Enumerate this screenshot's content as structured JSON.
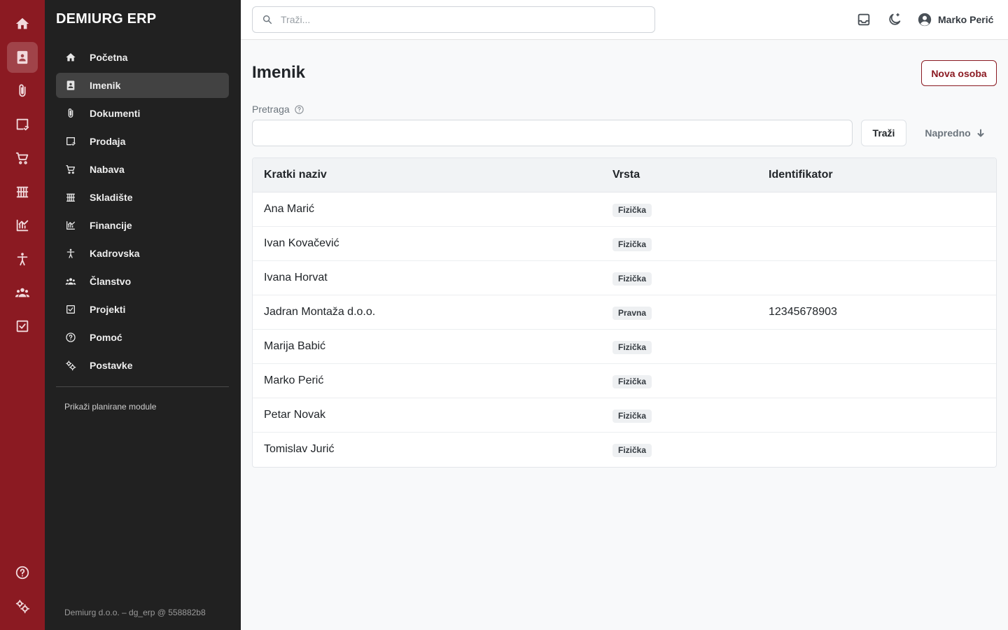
{
  "app": {
    "brand": "DEMIURG ERP",
    "accent_color": "#8b1a22",
    "sidebar_color": "#212121"
  },
  "rail": {
    "items": [
      {
        "icon": "home-icon"
      },
      {
        "icon": "contacts-book-icon",
        "active": true
      },
      {
        "icon": "paperclip-icon"
      },
      {
        "icon": "sales-icon"
      },
      {
        "icon": "cart-icon"
      },
      {
        "icon": "warehouse-icon"
      },
      {
        "icon": "finance-chart-icon"
      },
      {
        "icon": "person-icon"
      },
      {
        "icon": "group-icon"
      },
      {
        "icon": "checkbox-icon"
      }
    ],
    "bottom": [
      {
        "icon": "help-icon"
      },
      {
        "icon": "settings-icon"
      }
    ]
  },
  "sidebar": {
    "items": [
      {
        "label": "Početna",
        "icon": "home-icon"
      },
      {
        "label": "Imenik",
        "icon": "contacts-book-icon",
        "active": true
      },
      {
        "label": "Dokumenti",
        "icon": "paperclip-icon"
      },
      {
        "label": "Prodaja",
        "icon": "sales-icon"
      },
      {
        "label": "Nabava",
        "icon": "cart-icon"
      },
      {
        "label": "Skladište",
        "icon": "warehouse-icon"
      },
      {
        "label": "Financije",
        "icon": "finance-chart-icon"
      },
      {
        "label": "Kadrovska",
        "icon": "person-icon"
      },
      {
        "label": "Članstvo",
        "icon": "group-icon"
      },
      {
        "label": "Projekti",
        "icon": "checkbox-icon"
      },
      {
        "label": "Pomoć",
        "icon": "help-icon"
      },
      {
        "label": "Postavke",
        "icon": "settings-icon"
      }
    ],
    "planned_modules_link": "Prikaži planirane module",
    "footer": "Demiurg d.o.o. – dg_erp @ 558882b8"
  },
  "topbar": {
    "search_placeholder": "Traži...",
    "user_name": "Marko Perić"
  },
  "main": {
    "title": "Imenik",
    "new_button": "Nova osoba",
    "filter_label": "Pretraga",
    "filter_value": "",
    "search_button": "Traži",
    "advanced_button": "Napredno"
  },
  "table": {
    "columns": [
      "Kratki naziv",
      "Vrsta",
      "Identifikator"
    ],
    "rows": [
      {
        "name": "Ana Marić",
        "type": "Fizička",
        "id": ""
      },
      {
        "name": "Ivan Kovačević",
        "type": "Fizička",
        "id": ""
      },
      {
        "name": "Ivana Horvat",
        "type": "Fizička",
        "id": ""
      },
      {
        "name": "Jadran Montaža d.o.o.",
        "type": "Pravna",
        "id": "12345678903"
      },
      {
        "name": "Marija Babić",
        "type": "Fizička",
        "id": ""
      },
      {
        "name": "Marko Perić",
        "type": "Fizička",
        "id": ""
      },
      {
        "name": "Petar Novak",
        "type": "Fizička",
        "id": ""
      },
      {
        "name": "Tomislav Jurić",
        "type": "Fizička",
        "id": ""
      }
    ]
  }
}
